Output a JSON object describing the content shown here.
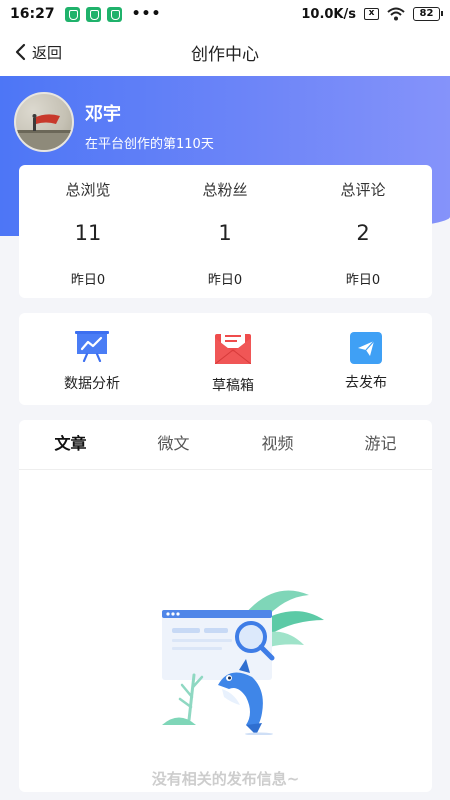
{
  "status_bar": {
    "time": "16:27",
    "more": "•••",
    "network_speed": "10.0K/s",
    "sim_icon_text": "x",
    "battery": "82"
  },
  "header": {
    "back_label": "返回",
    "title": "创作中心"
  },
  "profile": {
    "name": "邓宇",
    "days_text": "在平台创作的第110天"
  },
  "stats": [
    {
      "label": "总浏览",
      "value": "11",
      "yesterday": "昨日0"
    },
    {
      "label": "总粉丝",
      "value": "1",
      "yesterday": "昨日0"
    },
    {
      "label": "总评论",
      "value": "2",
      "yesterday": "昨日0"
    }
  ],
  "tools": [
    {
      "label": "数据分析",
      "icon": "chart-board-icon"
    },
    {
      "label": "草稿箱",
      "icon": "envelope-icon"
    },
    {
      "label": "去发布",
      "icon": "paper-plane-icon"
    }
  ],
  "tabs": [
    {
      "label": "文章",
      "active": true
    },
    {
      "label": "微文",
      "active": false
    },
    {
      "label": "视频",
      "active": false
    },
    {
      "label": "游记",
      "active": false
    }
  ],
  "empty_state": {
    "message": "没有相关的发布信息~"
  },
  "colors": {
    "banner_start": "#4d76f6",
    "banner_end": "#8593fa",
    "draft_red": "#ef4c4c",
    "publish_blue": "#3fa0f5",
    "analysis_blue": "#3c6ff0"
  }
}
